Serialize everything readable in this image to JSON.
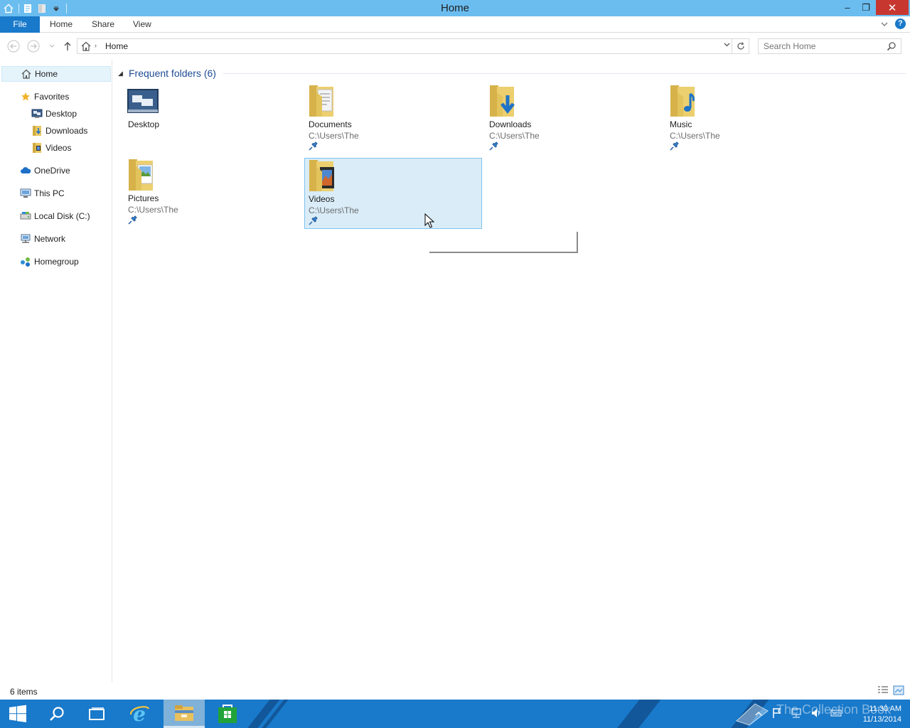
{
  "window": {
    "title": "Home",
    "minimize_glyph": "–",
    "restore_glyph": "❐",
    "close_glyph": "✕"
  },
  "ribbon": {
    "tabs": [
      "File",
      "Home",
      "Share",
      "View"
    ]
  },
  "address": {
    "breadcrumb": "Home",
    "search_placeholder": "Search Home"
  },
  "nav_pane": {
    "home": "Home",
    "favorites": "Favorites",
    "favorites_items": [
      "Desktop",
      "Downloads",
      "Videos"
    ],
    "onedrive": "OneDrive",
    "this_pc": "This PC",
    "local_disk": "Local Disk (C:)",
    "network": "Network",
    "homegroup": "Homegroup"
  },
  "content": {
    "group_title": "Frequent folders (6)",
    "folders": [
      {
        "name": "Desktop",
        "path": "",
        "pinned": false,
        "icon": "desktop-icon"
      },
      {
        "name": "Documents",
        "path": "C:\\Users\\The",
        "pinned": true,
        "icon": "documents-folder-icon"
      },
      {
        "name": "Downloads",
        "path": "C:\\Users\\The",
        "pinned": true,
        "icon": "downloads-folder-icon"
      },
      {
        "name": "Music",
        "path": "C:\\Users\\The",
        "pinned": true,
        "icon": "music-folder-icon"
      },
      {
        "name": "Pictures",
        "path": "C:\\Users\\The",
        "pinned": true,
        "icon": "pictures-folder-icon"
      },
      {
        "name": "Videos",
        "path": "C:\\Users\\The",
        "pinned": true,
        "icon": "videos-folder-icon",
        "selected": true
      }
    ]
  },
  "status_bar": {
    "item_count": "6 items"
  },
  "taskbar": {
    "watermark": "The Collection Book",
    "time": "11:30 AM",
    "date": "11/13/2014"
  },
  "colors": {
    "titlebar": "#6bbdf0",
    "accent": "#1979ca",
    "close": "#c7372f",
    "selection": "#d9ecf8"
  }
}
